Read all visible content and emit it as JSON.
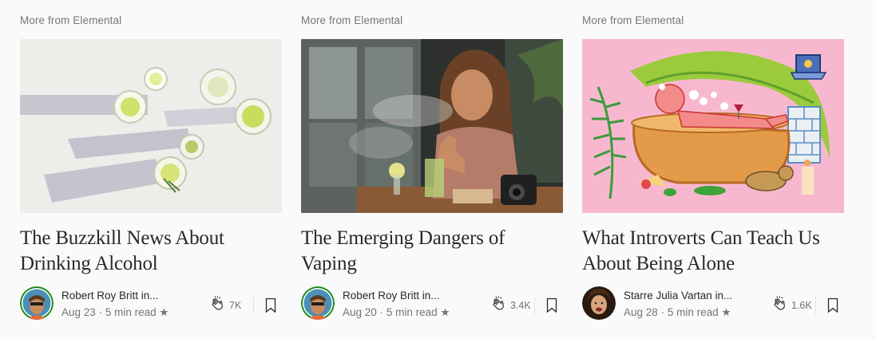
{
  "cards": [
    {
      "section": "More from Elemental",
      "title_line1": "The Buzzkill News About",
      "title_line2": "Drinking Alcohol",
      "author": "Robert Roy Britt in...",
      "date": "Aug 23",
      "sep": "·",
      "read_time": "5 min read",
      "star": "★",
      "claps": "7K",
      "image": "glasses-on-white-table"
    },
    {
      "section": "More from Elemental",
      "title_line1": "The Emerging Dangers of",
      "title_line2": "Vaping",
      "author": "Robert Roy Britt in...",
      "date": "Aug 20",
      "sep": "·",
      "read_time": "5 min read",
      "star": "★",
      "claps": "3.4K",
      "image": "woman-vaping-at-cafe"
    },
    {
      "section": "More from Elemental",
      "title_line1": "What Introverts Can Teach Us",
      "title_line2": "About Being Alone",
      "author": "Starre Julia Vartan in...",
      "date": "Aug 28",
      "sep": "·",
      "read_time": "5 min read",
      "star": "★",
      "claps": "1.6K",
      "image": "illustration-bathtub"
    }
  ],
  "colors": {
    "background": "#fafafa",
    "text": "#292929",
    "muted": "#757575",
    "avatar_ring": "#1a8917"
  }
}
